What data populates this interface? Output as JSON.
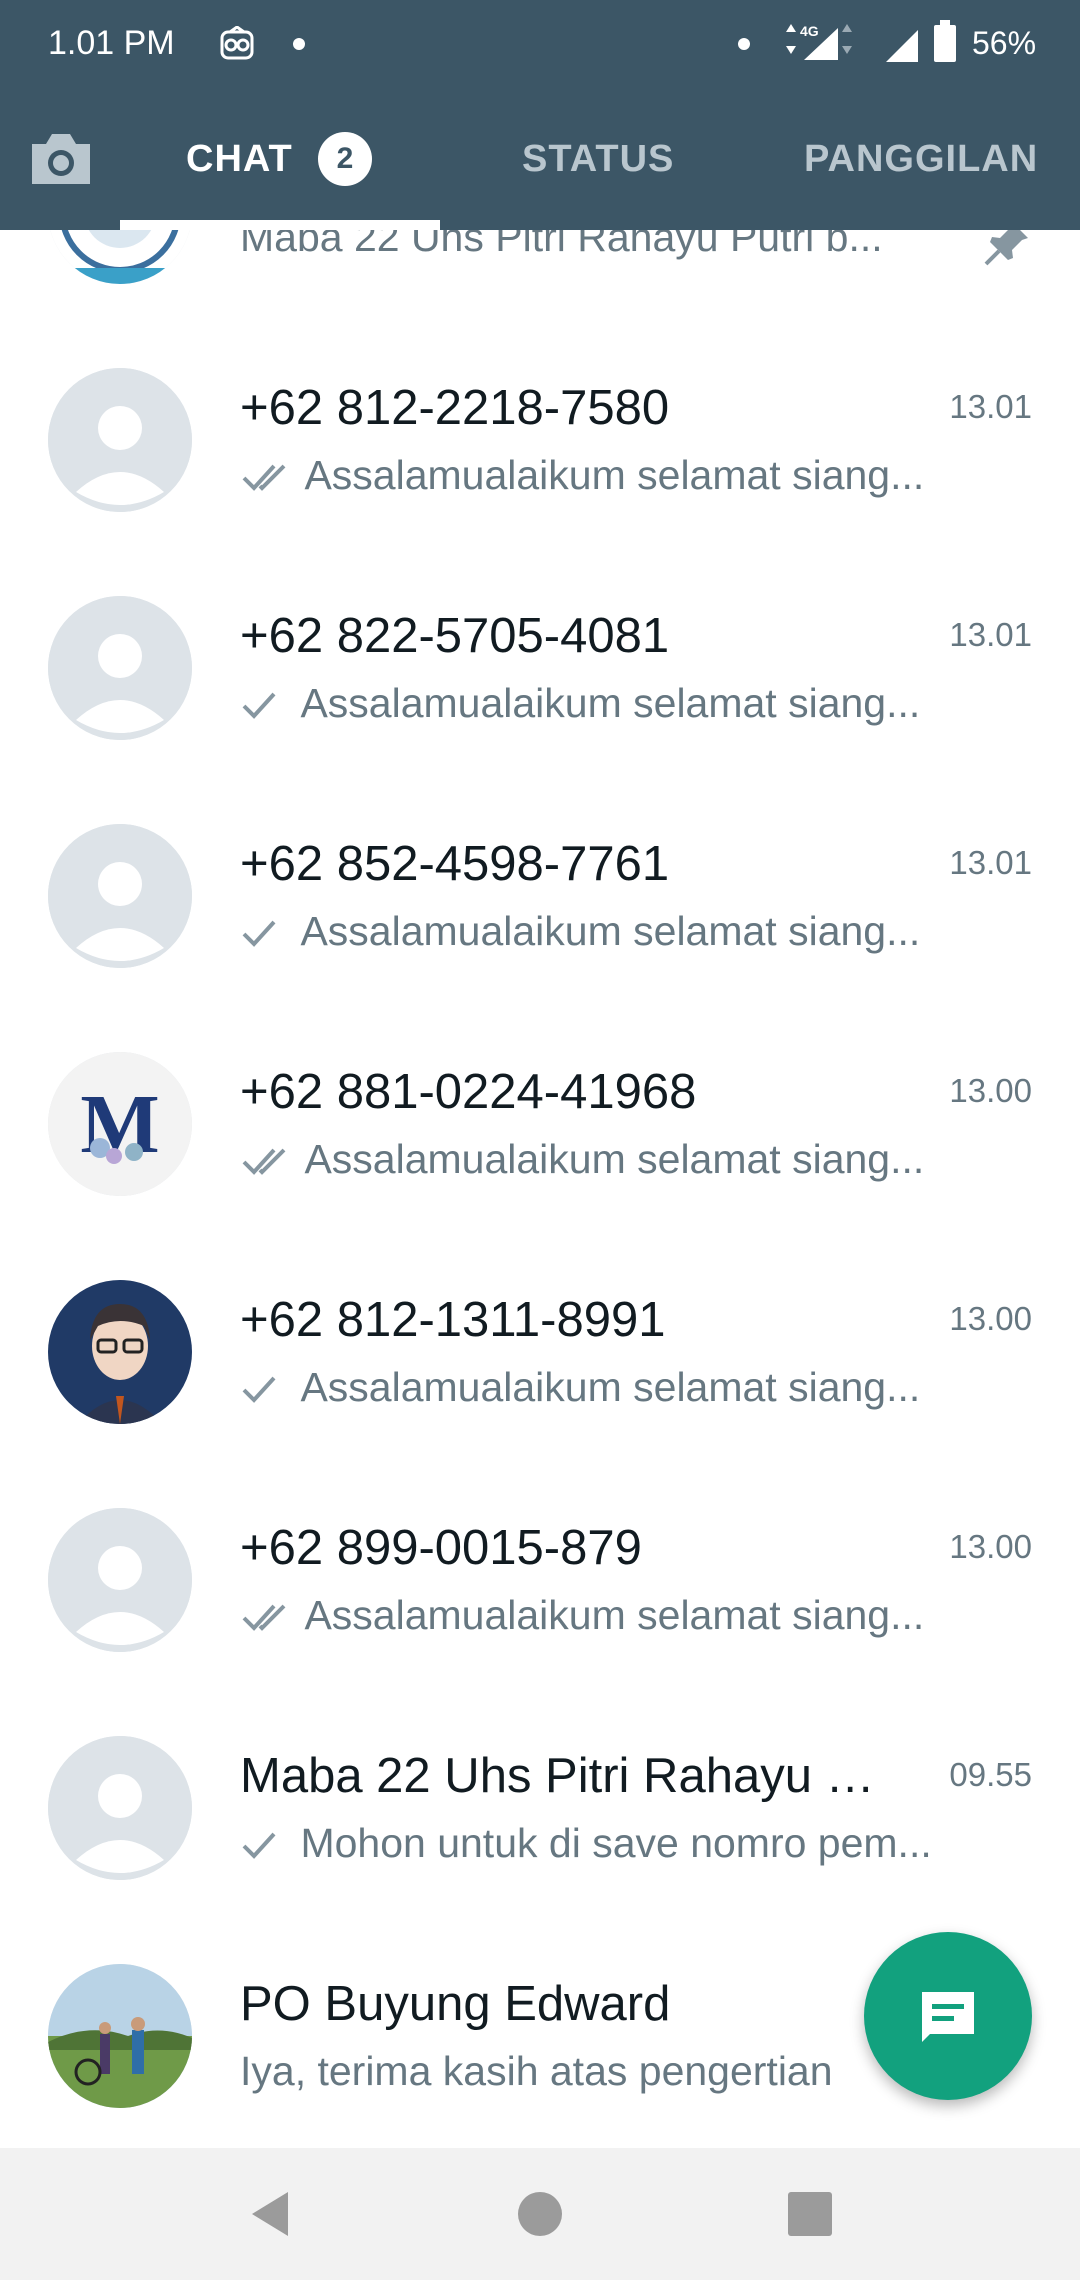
{
  "status_bar": {
    "time": "1.01 PM",
    "network": "4G",
    "battery": "56%",
    "icons": [
      "notification-app-icon",
      "signal-4g-icon",
      "signal-icon",
      "battery-icon"
    ]
  },
  "tabs": {
    "camera_icon": "camera-icon",
    "chat": "CHAT",
    "chat_badge": "2",
    "status": "STATUS",
    "calls": "PANGGILAN",
    "active": "CHAT"
  },
  "colors": {
    "header": "#3c5666",
    "accent": "#12a17e",
    "secondary_text": "#667781",
    "tick_read": "#8696a0"
  },
  "chats": [
    {
      "name": "",
      "preview": "Maba 22 Uhs Pitri Rahayu Putri b...",
      "time": "",
      "pinned": true,
      "tick": "none",
      "avatar": "group-logo"
    },
    {
      "name": "+62 812-2218-7580",
      "time": "13.01",
      "tick": "double",
      "preview": "Assalamualaikum selamat siang...",
      "avatar": "default"
    },
    {
      "name": "+62 822-5705-4081",
      "time": "13.01",
      "tick": "single",
      "preview": "Assalamualaikum selamat siang...",
      "avatar": "default"
    },
    {
      "name": "+62 852-4598-7761",
      "time": "13.01",
      "tick": "single",
      "preview": "Assalamualaikum selamat siang...",
      "avatar": "default"
    },
    {
      "name": "+62 881-0224-41968",
      "time": "13.00",
      "tick": "double",
      "preview": "Assalamualaikum selamat siang...",
      "avatar": "letter-m"
    },
    {
      "name": "+62 812-1311-8991",
      "time": "13.00",
      "tick": "single",
      "preview": "Assalamualaikum selamat siang...",
      "avatar": "anime-character"
    },
    {
      "name": "+62 899-0015-879",
      "time": "13.00",
      "tick": "double",
      "preview": "Assalamualaikum selamat siang...",
      "avatar": "default"
    },
    {
      "name": "Maba 22 Uhs Pitri Rahayu P...",
      "time": "09.55",
      "tick": "single",
      "preview": "Mohon untuk di save nomro pem...",
      "avatar": "default"
    },
    {
      "name": "PO Buyung Edward",
      "time": "",
      "tick": "none",
      "preview": "Iya, terima kasih atas pengertian",
      "avatar": "photo-landscape"
    }
  ],
  "fab": {
    "icon": "new-chat-icon"
  },
  "nav": {
    "back": "back-icon",
    "home": "home-icon",
    "recent": "recent-apps-icon"
  }
}
